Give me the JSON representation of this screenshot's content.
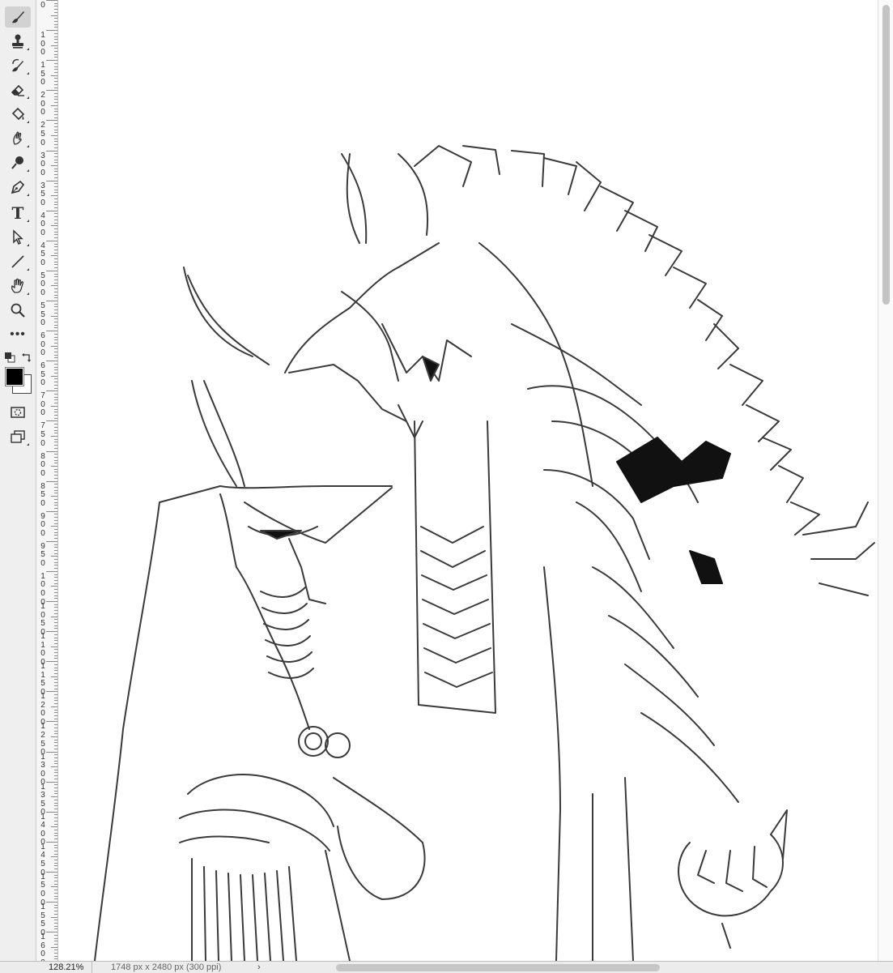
{
  "toolbar": {
    "tools": [
      {
        "name": "brush-tool",
        "icon": "brush-icon",
        "active": true
      },
      {
        "name": "clone-stamp-tool",
        "icon": "stamp-icon"
      },
      {
        "name": "history-brush-tool",
        "icon": "history-brush-icon"
      },
      {
        "name": "eraser-tool",
        "icon": "eraser-icon"
      },
      {
        "name": "paint-bucket-tool",
        "icon": "paint-bucket-icon"
      },
      {
        "name": "smudge-tool",
        "icon": "smudge-icon"
      },
      {
        "name": "dodge-tool",
        "icon": "dodge-icon"
      },
      {
        "name": "pen-tool",
        "icon": "pen-icon"
      },
      {
        "name": "type-tool",
        "icon": "type-icon",
        "glyph": "T"
      },
      {
        "name": "path-selection-tool",
        "icon": "arrow-icon"
      },
      {
        "name": "line-tool",
        "icon": "line-icon"
      },
      {
        "name": "hand-tool",
        "icon": "hand-icon"
      },
      {
        "name": "zoom-tool",
        "icon": "magnifier-icon"
      },
      {
        "name": "more-tools",
        "icon": "more-dots-icon",
        "glyph": "•••"
      }
    ],
    "foreground_color": "#000000",
    "background_color": "#ffffff"
  },
  "ruler": {
    "labels": [
      "0",
      "1\n0\n0",
      "1\n5\n0",
      "2\n0\n0",
      "2\n5\n0",
      "3\n0\n0",
      "3\n5\n0",
      "4\n0\n0",
      "4\n5\n0",
      "5\n0\n0",
      "5\n5\n0",
      "6\n0\n0",
      "6\n5\n0",
      "7\n0\n0",
      "7\n5\n0",
      "8\n0\n0",
      "8\n5\n0",
      "9\n0\n0",
      "9\n5\n0",
      "1\n0\n0\n0",
      "1\n0\n5\n0",
      "1\n1\n0\n0",
      "1\n1\n5\n0",
      "1\n2\n0\n0",
      "1\n2\n5\n0",
      "1\n3\n0\n0",
      "1\n3\n5\n0",
      "1\n4\n0\n0",
      "1\n4\n5\n0",
      "1\n5\n0\n0",
      "1\n5\n5\n0",
      "1\n6\n0\n0"
    ]
  },
  "canvas": {
    "description_free": true
  },
  "status": {
    "zoom": "128.21%",
    "doc_info": "1748 px x 2480 px (300 ppi)",
    "chevron": "›"
  }
}
